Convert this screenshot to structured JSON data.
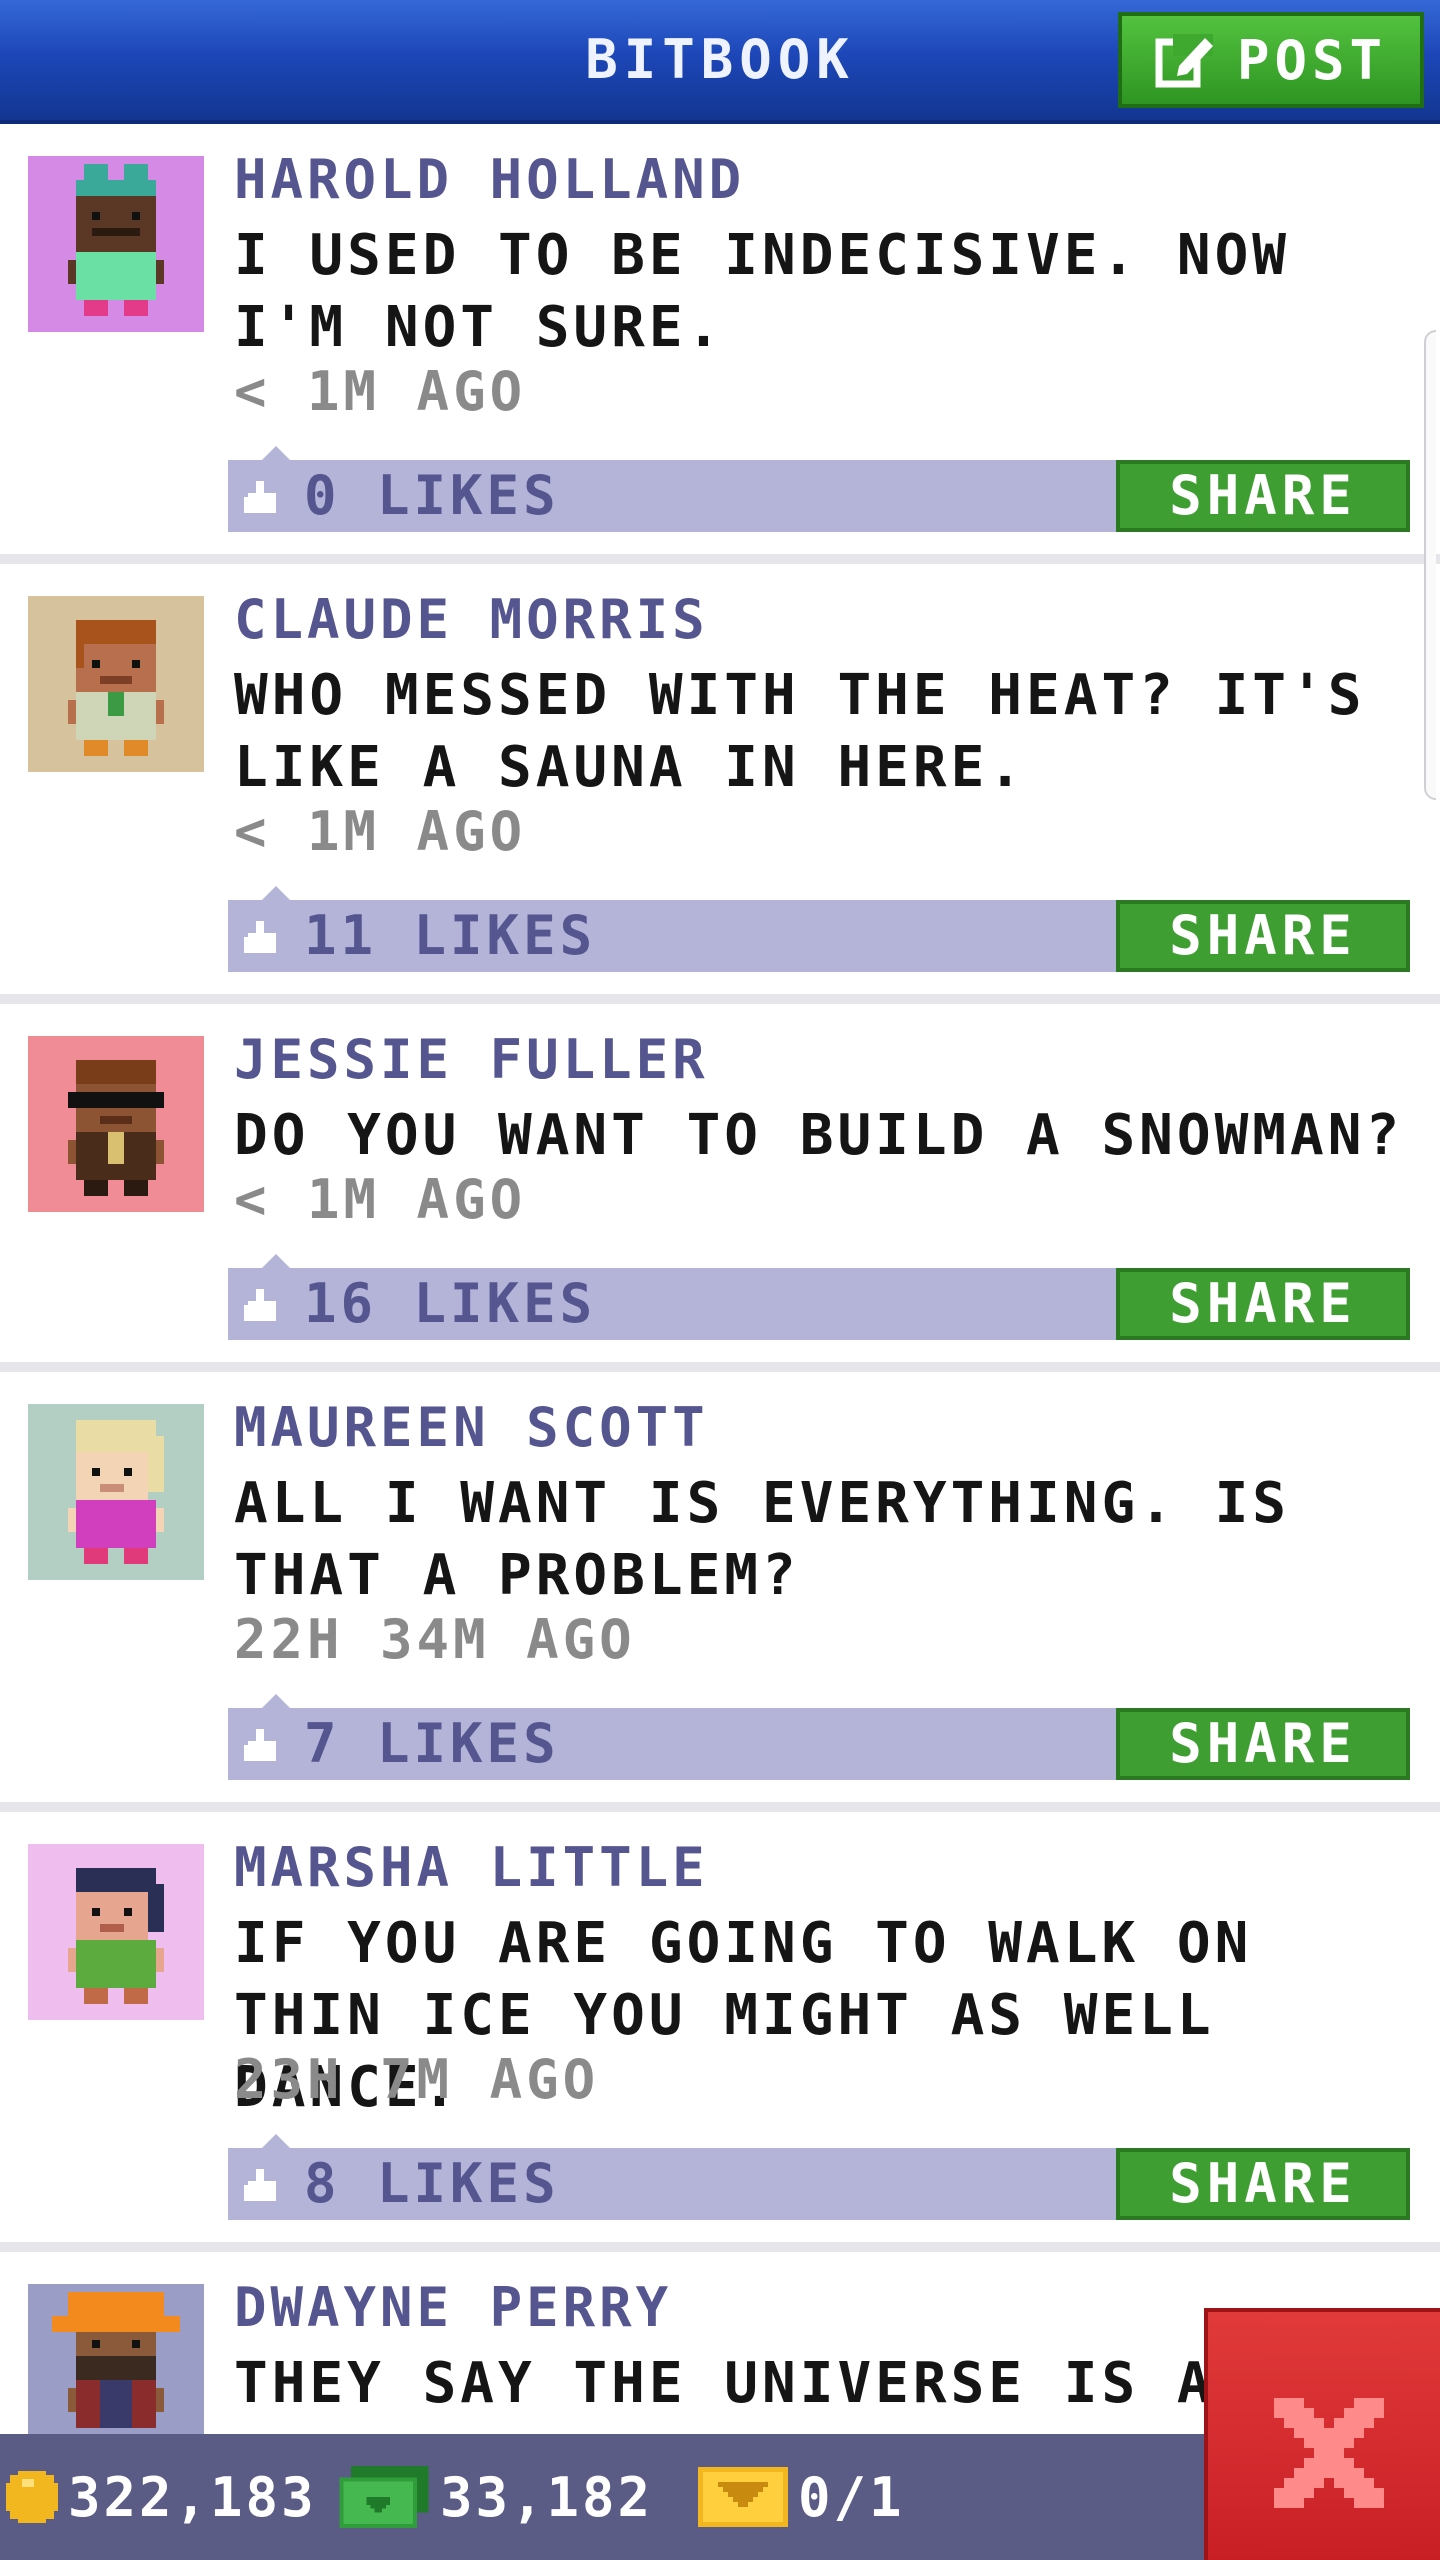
{
  "header": {
    "title": "BITBOOK",
    "post_label": "POST",
    "post_icon": "edit-icon"
  },
  "posts": [
    {
      "name": "HAROLD HOLLAND",
      "message": "I USED TO BE INDECISIVE. NOW I'M NOT SURE.",
      "time": "< 1M AGO",
      "likes": "0 LIKES",
      "share_label": "SHARE",
      "avatar_bg": "#d58be6"
    },
    {
      "name": "CLAUDE MORRIS",
      "message": "WHO MESSED WITH THE HEAT? IT'S LIKE A SAUNA IN HERE.",
      "time": "< 1M AGO",
      "likes": "11 LIKES",
      "share_label": "SHARE",
      "avatar_bg": "#d6c29d"
    },
    {
      "name": "JESSIE FULLER",
      "message": "DO YOU WANT TO BUILD A SNOWMAN?",
      "time": "< 1M AGO",
      "likes": "16 LIKES",
      "share_label": "SHARE",
      "avatar_bg": "#f08c96"
    },
    {
      "name": "MAUREEN SCOTT",
      "message": "ALL I WANT IS EVERYTHING. IS THAT A PROBLEM?",
      "time": "22H 34M AGO",
      "likes": "7 LIKES",
      "share_label": "SHARE",
      "avatar_bg": "#b3cfc3"
    },
    {
      "name": "MARSHA LITTLE",
      "message": "IF YOU ARE GOING TO WALK ON THIN ICE YOU MIGHT AS WELL DANCE.",
      "time": "23H 7M AGO",
      "likes": "8 LIKES",
      "share_label": "SHARE",
      "avatar_bg": "#efbdee"
    },
    {
      "name": "DWAYNE PERRY",
      "message": "THEY SAY THE UNIVERSE IS AT L",
      "avatar_bg": "#9a9ec7"
    }
  ],
  "status_bar": {
    "coins": "322,183",
    "bux": "33,182",
    "tickets": "0/1"
  },
  "colors": {
    "header_blue": "#1d47b8",
    "share_green": "#3f9e32",
    "likes_bar": "#b3b4d8",
    "name_purple": "#55558f",
    "close_red": "#d12a2e"
  }
}
